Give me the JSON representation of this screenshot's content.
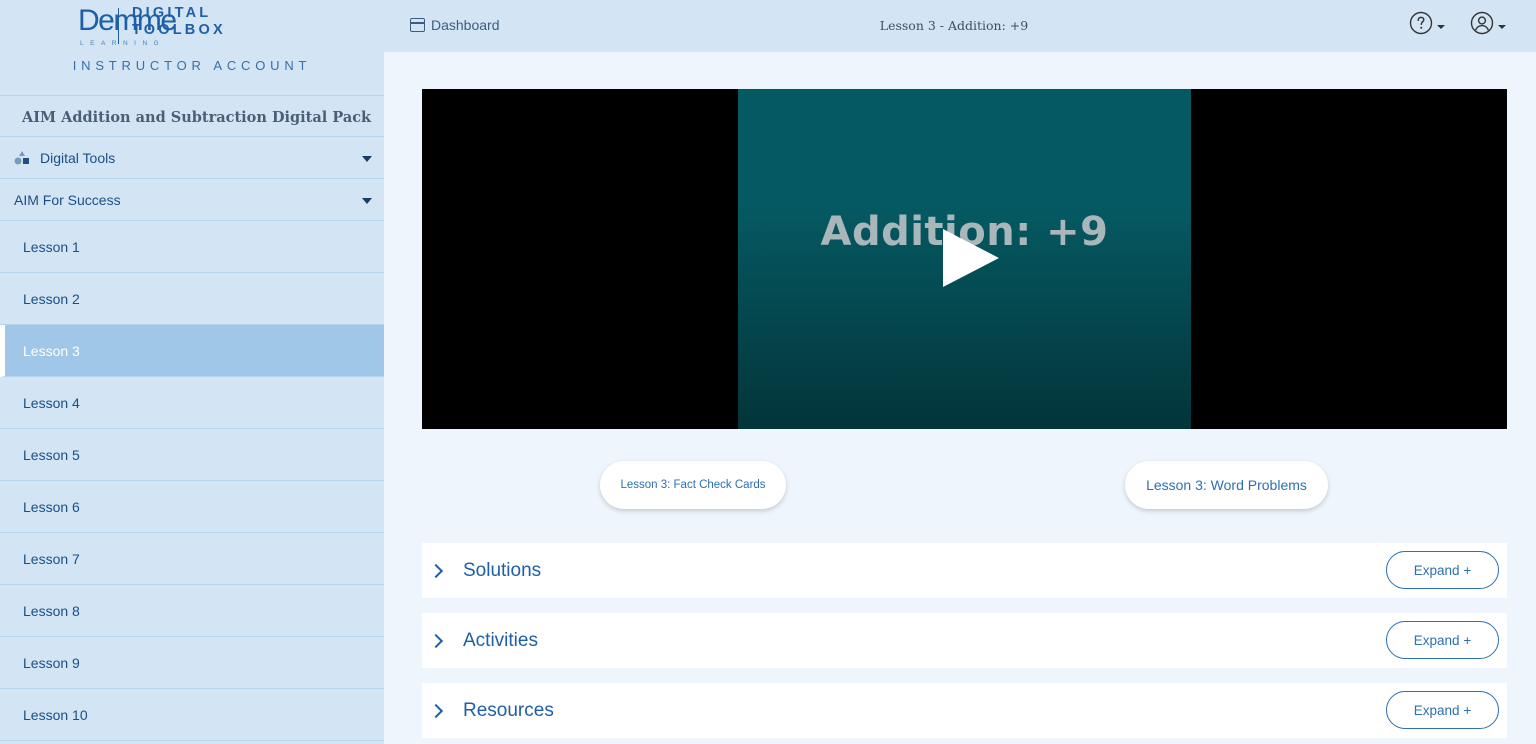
{
  "brand": {
    "logo_name": "Demme",
    "logo_sub": "LEARNING",
    "product_line1": "DIGITAL",
    "product_line2": "TOOLBOX",
    "account_label": "INSTRUCTOR ACCOUNT"
  },
  "sidebar": {
    "pack_title": "AIM Addition and Subtraction Digital Pack",
    "digital_tools": "Digital Tools",
    "aim_section": "AIM For Success",
    "lessons": [
      "Lesson 1",
      "Lesson 2",
      "Lesson 3",
      "Lesson 4",
      "Lesson 5",
      "Lesson 6",
      "Lesson 7",
      "Lesson 8",
      "Lesson 9",
      "Lesson 10"
    ],
    "active_lesson": "Lesson 3"
  },
  "header": {
    "dashboard_label": "Dashboard",
    "title": "Lesson 3 - Addition: +9",
    "help_icon": "question-circle-icon",
    "user_icon": "user-circle-icon"
  },
  "video": {
    "title_text": "Addition: +9",
    "play_icon": "play-icon"
  },
  "buttons": {
    "fact_cards": "Lesson 3: Fact Check Cards",
    "word_problems": "Lesson 3: Word Problems"
  },
  "sections": [
    {
      "label": "Solutions",
      "expand": "Expand +"
    },
    {
      "label": "Activities",
      "expand": "Expand +"
    },
    {
      "label": "Resources",
      "expand": "Expand +"
    }
  ],
  "colors": {
    "sidebar_bg": "#d3e5f5",
    "active_bg": "#a0c6e8",
    "accent": "#1f5fa6",
    "video_bg": "#055962"
  }
}
